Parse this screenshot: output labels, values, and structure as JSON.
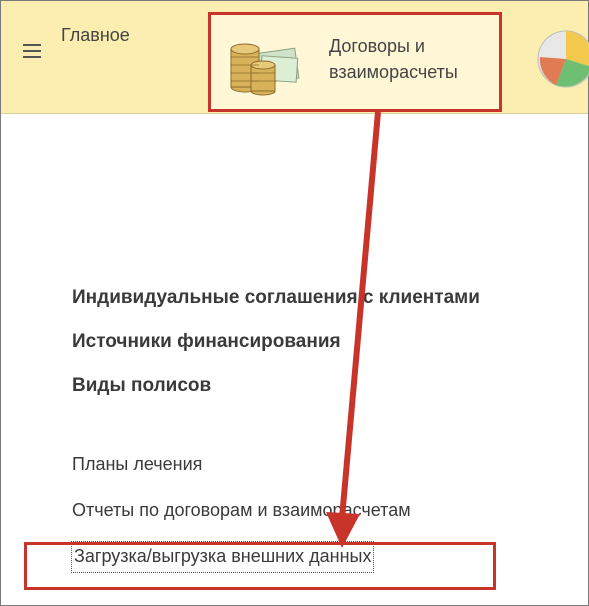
{
  "topbar": {
    "main_tab_label": "Главное",
    "contracts_tab_label": "Договоры и\nвзаиморасчеты",
    "menu_icon": "hamburger-menu-icon",
    "contracts_icon": "coins-money-icon",
    "next_tab_icon": "pie-chart-icon"
  },
  "links": {
    "bold": [
      "Индивидуальные соглашения с клиентами",
      "Источники финансирования",
      "Виды полисов"
    ],
    "normal": [
      "Планы лечения",
      "Отчеты по договорам и взаиморасчетам"
    ],
    "selected": "Загрузка/выгрузка внешних данных"
  },
  "colors": {
    "topbar_bg": "#fbeeb0",
    "highlight_red": "#c8342a"
  }
}
